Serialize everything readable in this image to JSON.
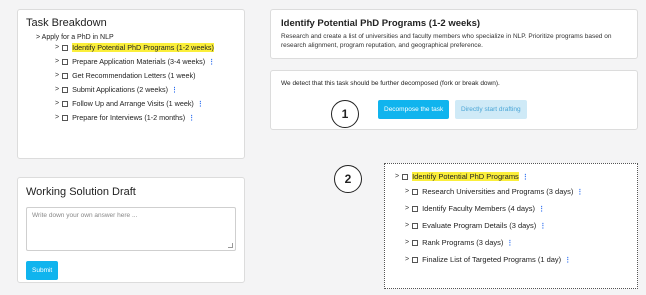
{
  "task_breakdown": {
    "title": "Task Breakdown",
    "root": "> Apply for a PhD in NLP",
    "items": [
      {
        "label": "Identify Potential PhD Programs (1-2 weeks)",
        "highlighted": true,
        "more": false
      },
      {
        "label": "Prepare Application Materials (3-4 weeks)",
        "highlighted": false,
        "more": true
      },
      {
        "label": "Get Recommendation Letters (1 week)",
        "highlighted": false,
        "more": false
      },
      {
        "label": "Submit Applications (2 weeks)",
        "highlighted": false,
        "more": true
      },
      {
        "label": "Follow Up and Arrange Visits (1 week)",
        "highlighted": false,
        "more": true
      },
      {
        "label": "Prepare for Interviews (1-2 months)",
        "highlighted": false,
        "more": true
      }
    ]
  },
  "draft": {
    "title": "Working Solution Draft",
    "placeholder": "Write down your own answer here ...",
    "submit_label": "Submit"
  },
  "task_detail": {
    "title": "Identify Potential PhD Programs (1-2 weeks)",
    "description": "Research and create a list of universities and faculty members who specialize in NLP. Prioritize programs based on research alignment, program reputation, and geographical preference."
  },
  "decompose_prompt": {
    "message": "We detect that this task should be further decomposed (fork or break down).",
    "decompose_label": "Decompose the task",
    "draft_label": "Directly start drafting"
  },
  "steps": {
    "one": "1",
    "two": "2"
  },
  "subtree": {
    "parent": "Identify Potential PhD Programs",
    "children": [
      "Research Universities and Programs (3 days)",
      "Identify Faculty Members (4 days)",
      "Evaluate Program Details (3 days)",
      "Rank Programs (3 days)",
      "Finalize List of Targeted Programs (1 day)"
    ]
  },
  "colors": {
    "accent": "#10b4ee",
    "highlight": "#fbef3a",
    "more_dots": "#2a6df0"
  },
  "icons": {
    "chevron": "chevron-right-icon",
    "checkbox": "checkbox-icon",
    "more": "more-vertical-icon"
  }
}
